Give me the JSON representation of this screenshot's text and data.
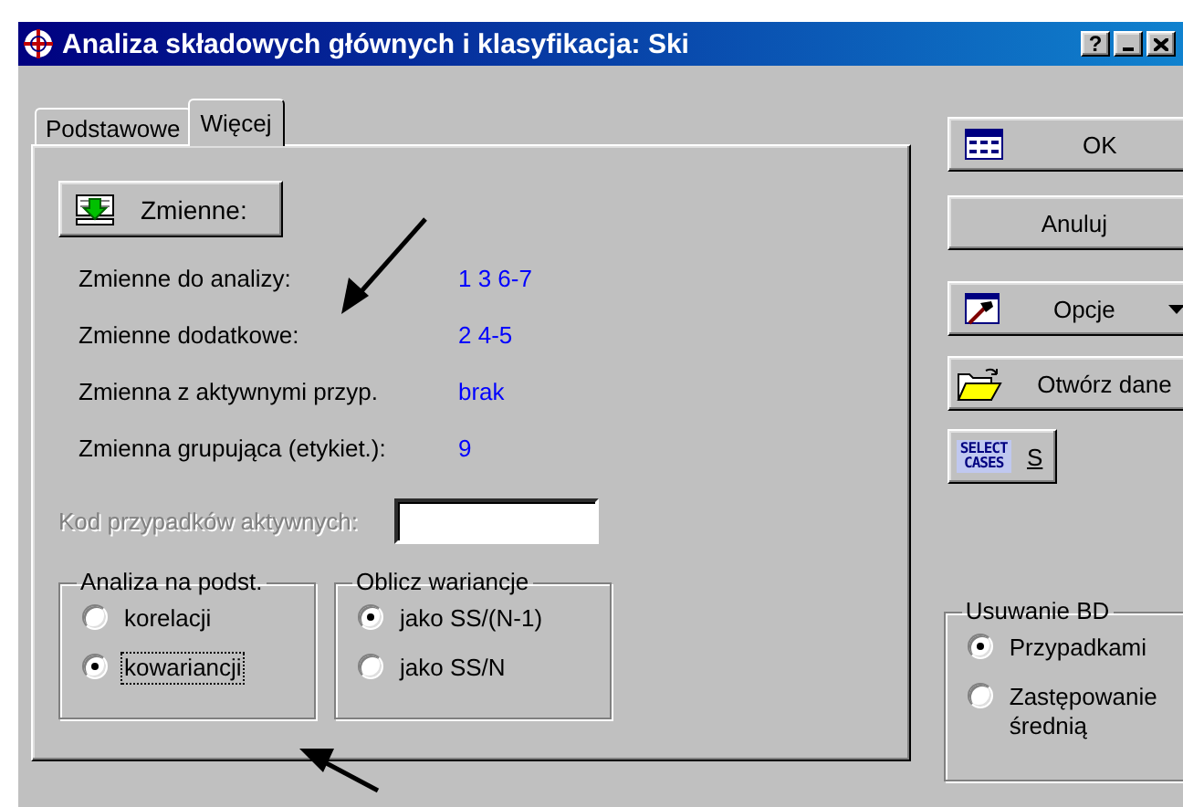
{
  "window": {
    "title": "Analiza składowych głównych i klasyfikacja: Ski",
    "controls": [
      {
        "kind": "help",
        "label": "?"
      },
      {
        "kind": "minimize"
      },
      {
        "kind": "close"
      }
    ]
  },
  "tabs": [
    {
      "label": "Podstawowe",
      "selected": false
    },
    {
      "label": "Więcej",
      "selected": true
    }
  ],
  "panel": {
    "variables_button": "Zmienne:",
    "summary": [
      {
        "label": "Zmienne do analizy:",
        "value": "1 3 6-7"
      },
      {
        "label": "Zmienne dodatkowe:",
        "value": "2 4-5"
      },
      {
        "label": "Zmienna z aktywnymi przyp.",
        "value": "brak"
      },
      {
        "label": "Zmienna grupująca (etykiet.):",
        "value": "9"
      }
    ],
    "active_cases": {
      "label": "Kod przypadków aktywnych:",
      "disabled": true
    },
    "groups": [
      {
        "title": "Analiza na podst.",
        "options": [
          {
            "label": "korelacji",
            "selected": false,
            "focused": false
          },
          {
            "label": "kowariancji",
            "selected": true,
            "focused": true
          }
        ]
      },
      {
        "title": "Oblicz wariancje",
        "options": [
          {
            "label": "jako SS/(N-1)",
            "selected": true,
            "focused": false
          },
          {
            "label": "jako SS/N",
            "selected": false,
            "focused": false
          }
        ]
      }
    ]
  },
  "side_buttons": [
    {
      "kind": "ok",
      "label": "OK"
    },
    {
      "kind": "cancel",
      "label": "Anuluj"
    },
    {
      "kind": "options",
      "label": "Opcje"
    },
    {
      "kind": "open",
      "label": "Otwórz dane"
    },
    {
      "kind": "select_cases",
      "label": "S",
      "icon_text": [
        "SELECT",
        "CASES"
      ]
    }
  ],
  "missing_data": {
    "title": "Usuwanie BD",
    "options": [
      {
        "label": "Przypadkami",
        "selected": true,
        "focused": false
      },
      {
        "label": "Zastępowanie średnią",
        "selected": false,
        "focused": false
      }
    ]
  }
}
